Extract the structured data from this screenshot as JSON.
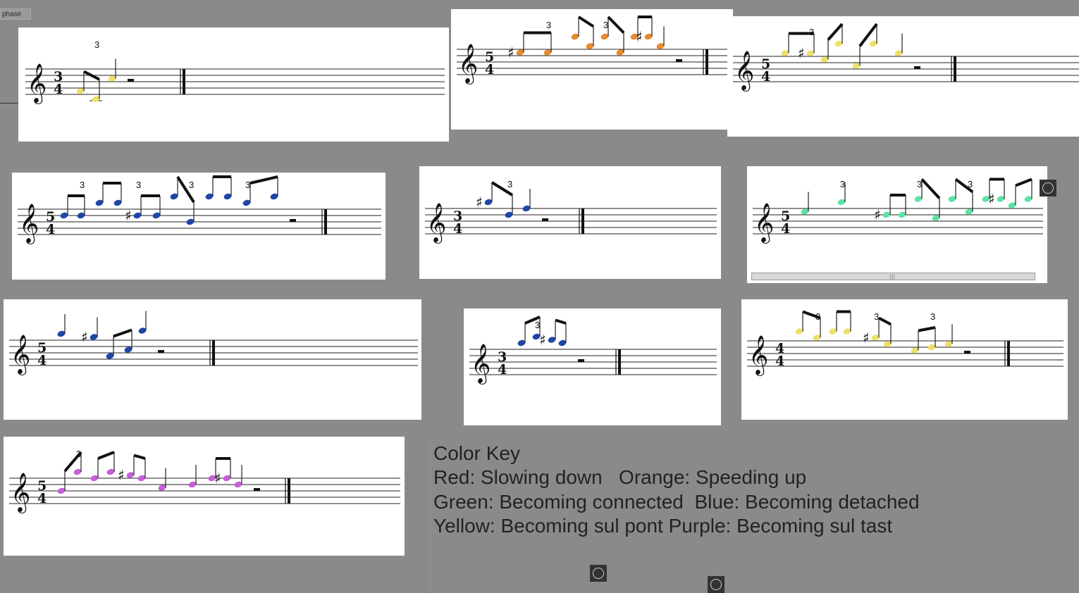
{
  "phase_button": {
    "label": "phase"
  },
  "color_key": {
    "title": "Color Key",
    "lines": [
      "Red: Slowing down   Orange: Speeding up",
      "Green: Becoming connected  Blue: Becoming detached",
      "Yellow: Becoming sul pont Purple: Becoming sul tast"
    ]
  },
  "colors": {
    "red": "#d33",
    "orange": "#e8892e",
    "green": "#5ee3a6",
    "blue": "#1f45a8",
    "yellow": "#ede06a",
    "purple": "#c65fd8",
    "background": "#8a8a8a"
  },
  "icons": {
    "window_button": "circle-icon",
    "scroll_grip": "grip-icon"
  },
  "scores": [
    {
      "id": "score-1",
      "time_signature": [
        "3",
        "4"
      ],
      "color": "yellow",
      "tuplets": [
        "3"
      ]
    },
    {
      "id": "score-2",
      "time_signature": [
        "5",
        "4"
      ],
      "color": "orange",
      "tuplets": [
        "3",
        "3"
      ]
    },
    {
      "id": "score-3",
      "time_signature": [
        "5",
        "4"
      ],
      "color": "yellow",
      "tuplets": [
        "3"
      ]
    },
    {
      "id": "score-4",
      "time_signature": [
        "5",
        "4"
      ],
      "color": "blue",
      "tuplets": [
        "3",
        "3",
        "3",
        "3"
      ]
    },
    {
      "id": "score-5",
      "time_signature": [
        "3",
        "4"
      ],
      "color": "blue",
      "tuplets": [
        "3"
      ]
    },
    {
      "id": "score-6",
      "time_signature": [
        "5",
        "4"
      ],
      "color": "green",
      "tuplets": [
        "3",
        "3",
        "3"
      ]
    },
    {
      "id": "score-7",
      "time_signature": [
        "5",
        "4"
      ],
      "color": "blue",
      "tuplets": []
    },
    {
      "id": "score-8",
      "time_signature": [
        "3",
        "4"
      ],
      "color": "blue",
      "tuplets": [
        "3"
      ]
    },
    {
      "id": "score-9",
      "time_signature": [
        "4",
        "4"
      ],
      "color": "yellow",
      "tuplets": [
        "3",
        "3",
        "3"
      ]
    },
    {
      "id": "score-10",
      "time_signature": [
        "5",
        "4"
      ],
      "color": "purple",
      "tuplets": [
        "3"
      ]
    }
  ]
}
